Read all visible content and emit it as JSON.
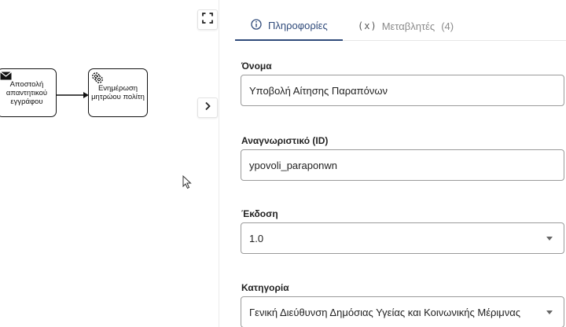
{
  "canvas": {
    "tasks": [
      {
        "label": "Αποστολή απαντητικού εγγράφου",
        "type": "send",
        "icon": "envelope-icon"
      },
      {
        "label": "Ενημέρωση μητρώου πολίτη",
        "type": "service",
        "icon": "gear-icon"
      }
    ],
    "buttons": {
      "fullscreen_icon": "fullscreen-icon",
      "collapse_icon": "chevron-right-icon"
    }
  },
  "panel": {
    "tabs": {
      "info": {
        "label": "Πληροφορίες",
        "icon": "info-icon"
      },
      "variables": {
        "symbol": "(x)",
        "label": "Μεταβλητές",
        "count": "(4)"
      }
    },
    "fields": {
      "name": {
        "label": "Όνομα",
        "value": "Υποβολή Αίτησης Παραπόνων"
      },
      "id": {
        "label": "Αναγνωριστικό (ID)",
        "value": "ypovoli_paraponwn"
      },
      "version": {
        "label": "Έκδοση",
        "value": "1.0"
      },
      "category": {
        "label": "Κατηγορία",
        "value": "Γενική Διεύθυνση Δημόσιας Υγείας και Κοινωνικής Μέριμνας"
      }
    }
  },
  "colors": {
    "accent": "#2f4a7a",
    "border": "#9a9a9a"
  }
}
